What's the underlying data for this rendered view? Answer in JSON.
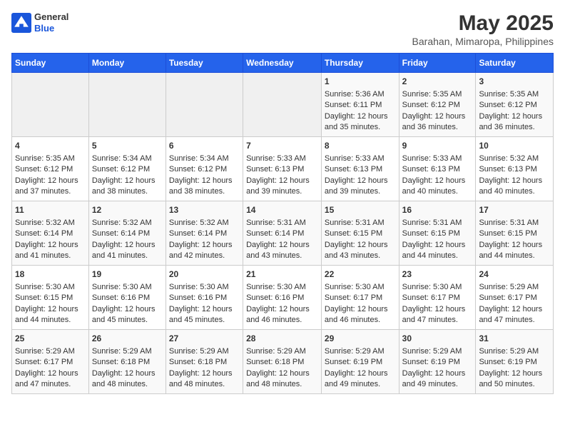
{
  "logo": {
    "general": "General",
    "blue": "Blue"
  },
  "title": "May 2025",
  "subtitle": "Barahan, Mimaropa, Philippines",
  "days": [
    "Sunday",
    "Monday",
    "Tuesday",
    "Wednesday",
    "Thursday",
    "Friday",
    "Saturday"
  ],
  "weeks": [
    [
      {
        "day": "",
        "content": ""
      },
      {
        "day": "",
        "content": ""
      },
      {
        "day": "",
        "content": ""
      },
      {
        "day": "",
        "content": ""
      },
      {
        "day": "1",
        "content": "Sunrise: 5:36 AM\nSunset: 6:11 PM\nDaylight: 12 hours and 35 minutes."
      },
      {
        "day": "2",
        "content": "Sunrise: 5:35 AM\nSunset: 6:12 PM\nDaylight: 12 hours and 36 minutes."
      },
      {
        "day": "3",
        "content": "Sunrise: 5:35 AM\nSunset: 6:12 PM\nDaylight: 12 hours and 36 minutes."
      }
    ],
    [
      {
        "day": "4",
        "content": "Sunrise: 5:35 AM\nSunset: 6:12 PM\nDaylight: 12 hours and 37 minutes."
      },
      {
        "day": "5",
        "content": "Sunrise: 5:34 AM\nSunset: 6:12 PM\nDaylight: 12 hours and 38 minutes."
      },
      {
        "day": "6",
        "content": "Sunrise: 5:34 AM\nSunset: 6:12 PM\nDaylight: 12 hours and 38 minutes."
      },
      {
        "day": "7",
        "content": "Sunrise: 5:33 AM\nSunset: 6:13 PM\nDaylight: 12 hours and 39 minutes."
      },
      {
        "day": "8",
        "content": "Sunrise: 5:33 AM\nSunset: 6:13 PM\nDaylight: 12 hours and 39 minutes."
      },
      {
        "day": "9",
        "content": "Sunrise: 5:33 AM\nSunset: 6:13 PM\nDaylight: 12 hours and 40 minutes."
      },
      {
        "day": "10",
        "content": "Sunrise: 5:32 AM\nSunset: 6:13 PM\nDaylight: 12 hours and 40 minutes."
      }
    ],
    [
      {
        "day": "11",
        "content": "Sunrise: 5:32 AM\nSunset: 6:14 PM\nDaylight: 12 hours and 41 minutes."
      },
      {
        "day": "12",
        "content": "Sunrise: 5:32 AM\nSunset: 6:14 PM\nDaylight: 12 hours and 41 minutes."
      },
      {
        "day": "13",
        "content": "Sunrise: 5:32 AM\nSunset: 6:14 PM\nDaylight: 12 hours and 42 minutes."
      },
      {
        "day": "14",
        "content": "Sunrise: 5:31 AM\nSunset: 6:14 PM\nDaylight: 12 hours and 43 minutes."
      },
      {
        "day": "15",
        "content": "Sunrise: 5:31 AM\nSunset: 6:15 PM\nDaylight: 12 hours and 43 minutes."
      },
      {
        "day": "16",
        "content": "Sunrise: 5:31 AM\nSunset: 6:15 PM\nDaylight: 12 hours and 44 minutes."
      },
      {
        "day": "17",
        "content": "Sunrise: 5:31 AM\nSunset: 6:15 PM\nDaylight: 12 hours and 44 minutes."
      }
    ],
    [
      {
        "day": "18",
        "content": "Sunrise: 5:30 AM\nSunset: 6:15 PM\nDaylight: 12 hours and 44 minutes."
      },
      {
        "day": "19",
        "content": "Sunrise: 5:30 AM\nSunset: 6:16 PM\nDaylight: 12 hours and 45 minutes."
      },
      {
        "day": "20",
        "content": "Sunrise: 5:30 AM\nSunset: 6:16 PM\nDaylight: 12 hours and 45 minutes."
      },
      {
        "day": "21",
        "content": "Sunrise: 5:30 AM\nSunset: 6:16 PM\nDaylight: 12 hours and 46 minutes."
      },
      {
        "day": "22",
        "content": "Sunrise: 5:30 AM\nSunset: 6:17 PM\nDaylight: 12 hours and 46 minutes."
      },
      {
        "day": "23",
        "content": "Sunrise: 5:30 AM\nSunset: 6:17 PM\nDaylight: 12 hours and 47 minutes."
      },
      {
        "day": "24",
        "content": "Sunrise: 5:29 AM\nSunset: 6:17 PM\nDaylight: 12 hours and 47 minutes."
      }
    ],
    [
      {
        "day": "25",
        "content": "Sunrise: 5:29 AM\nSunset: 6:17 PM\nDaylight: 12 hours and 47 minutes."
      },
      {
        "day": "26",
        "content": "Sunrise: 5:29 AM\nSunset: 6:18 PM\nDaylight: 12 hours and 48 minutes."
      },
      {
        "day": "27",
        "content": "Sunrise: 5:29 AM\nSunset: 6:18 PM\nDaylight: 12 hours and 48 minutes."
      },
      {
        "day": "28",
        "content": "Sunrise: 5:29 AM\nSunset: 6:18 PM\nDaylight: 12 hours and 48 minutes."
      },
      {
        "day": "29",
        "content": "Sunrise: 5:29 AM\nSunset: 6:19 PM\nDaylight: 12 hours and 49 minutes."
      },
      {
        "day": "30",
        "content": "Sunrise: 5:29 AM\nSunset: 6:19 PM\nDaylight: 12 hours and 49 minutes."
      },
      {
        "day": "31",
        "content": "Sunrise: 5:29 AM\nSunset: 6:19 PM\nDaylight: 12 hours and 50 minutes."
      }
    ]
  ]
}
